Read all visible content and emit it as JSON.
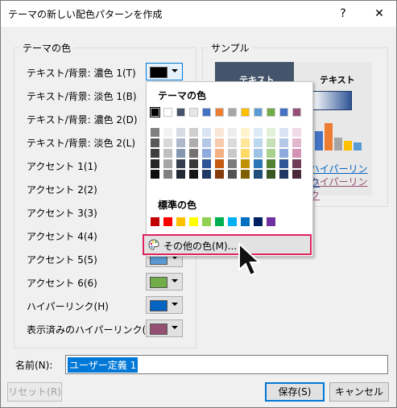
{
  "window": {
    "title": "テーマの新しい配色パターンを作成",
    "help": "?",
    "close": "✕"
  },
  "theme_colors": {
    "label": "テーマの色",
    "rows": [
      {
        "label": "テキスト/背景: 濃色 1(T)",
        "color": "#000000"
      },
      {
        "label": "テキスト/背景: 淡色 1(B)",
        "color": "#ffffff"
      },
      {
        "label": "テキスト/背景: 濃色 2(D)",
        "color": "#44546a"
      },
      {
        "label": "テキスト/背景: 淡色 2(L)",
        "color": "#e7e6e6"
      },
      {
        "label": "アクセント 1(1)",
        "color": "#4472c4"
      },
      {
        "label": "アクセント 2(2)",
        "color": "#ed7d31"
      },
      {
        "label": "アクセント 3(3)",
        "color": "#a5a5a5"
      },
      {
        "label": "アクセント 4(4)",
        "color": "#ffc000"
      },
      {
        "label": "アクセント 5(5)",
        "color": "#5b9bd5"
      },
      {
        "label": "アクセント 6(6)",
        "color": "#70ad47"
      },
      {
        "label": "ハイパーリンク(H)",
        "color": "#0563c1"
      },
      {
        "label": "表示済みのハイパーリンク(F)",
        "color": "#954f72"
      }
    ]
  },
  "sample": {
    "label": "サンプル",
    "text_dark": "テキスト",
    "text_light": "テキスト",
    "link": "ハイパーリンク",
    "visited_link": "ハイパーリンク"
  },
  "popup": {
    "theme_label": "テーマの色",
    "standard_label": "標準の色",
    "more_colors": "その他の色(M)...",
    "theme_top": [
      "#000000",
      "#ffffff",
      "#44546a",
      "#e7e6e6",
      "#4472c4",
      "#ed7d31",
      "#a5a5a5",
      "#ffc000",
      "#5b9bd5",
      "#70ad47",
      "#4472c4",
      "#954f72"
    ],
    "shades": [
      [
        "#7f7f7f",
        "#f2f2f2",
        "#d6dce4",
        "#d0cece",
        "#dae3f3",
        "#fbe5d6",
        "#ededed",
        "#fff2cc",
        "#deebf7",
        "#e2f0d9",
        "#dae3f3",
        "#f0dbe6"
      ],
      [
        "#595959",
        "#d9d9d9",
        "#adb9ca",
        "#aeabab",
        "#b4c7e7",
        "#f8cbad",
        "#dbdbdb",
        "#ffe699",
        "#bdd7ee",
        "#c5e0b4",
        "#b4c7e7",
        "#e2b7cd"
      ],
      [
        "#3f3f3f",
        "#bfbfbf",
        "#8497b0",
        "#757171",
        "#8faadc",
        "#f4b183",
        "#c9c9c9",
        "#ffd966",
        "#9dc3e6",
        "#a9d18e",
        "#8faadc",
        "#d393b4"
      ],
      [
        "#262626",
        "#a6a6a6",
        "#333f50",
        "#3a3838",
        "#2f5597",
        "#c55a11",
        "#7b7b7b",
        "#bf9000",
        "#2e75b6",
        "#548235",
        "#2f5597",
        "#6f3b56"
      ],
      [
        "#0d0d0d",
        "#808080",
        "#222a35",
        "#171616",
        "#1f3864",
        "#843c0c",
        "#525252",
        "#7f6000",
        "#1f4e79",
        "#385723",
        "#1f3864",
        "#4a273a"
      ]
    ],
    "standard": [
      "#c00000",
      "#ff0000",
      "#ffc000",
      "#ffff00",
      "#92d050",
      "#00b050",
      "#00b0f0",
      "#0070c0",
      "#002060",
      "#7030a0"
    ]
  },
  "name_field": {
    "label": "名前(N):",
    "value": "ユーザー定義 1"
  },
  "buttons": {
    "reset": "リセット(R)",
    "save": "保存(S)",
    "cancel": "キャンセル"
  }
}
